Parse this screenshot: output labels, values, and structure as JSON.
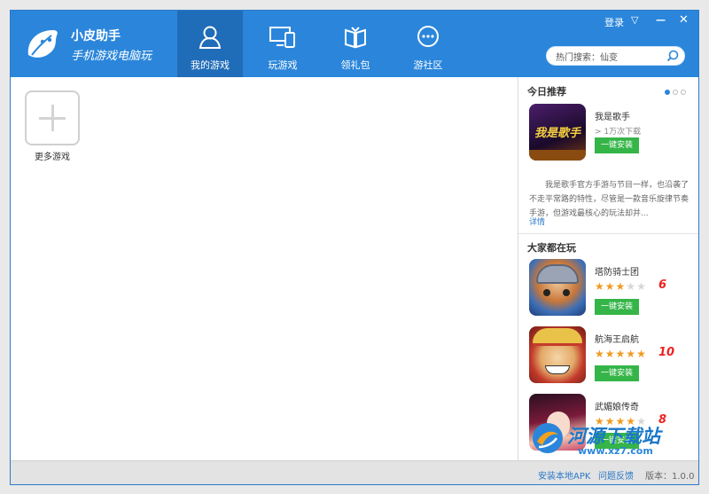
{
  "brand": {
    "name": "小皮助手",
    "subtitle": "手机游戏电脑玩"
  },
  "nav": [
    {
      "label": "我的游戏",
      "icon": "user-icon",
      "active": true
    },
    {
      "label": "玩游戏",
      "icon": "devices-icon",
      "active": false
    },
    {
      "label": "领礼包",
      "icon": "gift-book-icon",
      "active": false
    },
    {
      "label": "游社区",
      "icon": "chat-bubble-icon",
      "active": false
    }
  ],
  "window_controls": {
    "login": "登录",
    "menu": "▽",
    "minimize": "—",
    "close": "✕"
  },
  "search": {
    "value": "热门搜索：仙变",
    "placeholder": "热门搜索：仙变"
  },
  "my_games": {
    "add_label": "更多游戏"
  },
  "today": {
    "title": "今日推荐",
    "carousel_pages": 3,
    "carousel_active": 1,
    "game": {
      "name": "我是歌手",
      "downloads": "> 1万次下载",
      "install": "一键安装",
      "icon_text": "我是歌手",
      "description": "我是歌手官方手游与节目一样，也沿袭了不走平常路的特性，尽管是一款音乐旋律节奏手游，但游戏最核心的玩法却并...",
      "more": "详情"
    }
  },
  "popular": {
    "title": "大家都在玩",
    "games": [
      {
        "name": "塔防骑士团",
        "stars": 3,
        "max_stars": 5,
        "score": "6",
        "install": "一键安装"
      },
      {
        "name": "航海王启航",
        "stars": 5,
        "max_stars": 5,
        "score": "10",
        "install": "一键安装"
      },
      {
        "name": "武媚娘传奇",
        "stars": 4,
        "max_stars": 5,
        "score": "8",
        "install": "一键安装"
      }
    ]
  },
  "footer": {
    "install_apk": "安装本地APK",
    "feedback": "问题反馈",
    "version": "版本：1.0.0"
  },
  "watermark": {
    "text": "河源下载站",
    "url": "www.xz7.com"
  },
  "colors": {
    "header": "#2b86db",
    "nav_active": "#1f6cb8",
    "install_button": "#35b548",
    "star": "#f09b21",
    "score": "#e22222"
  }
}
